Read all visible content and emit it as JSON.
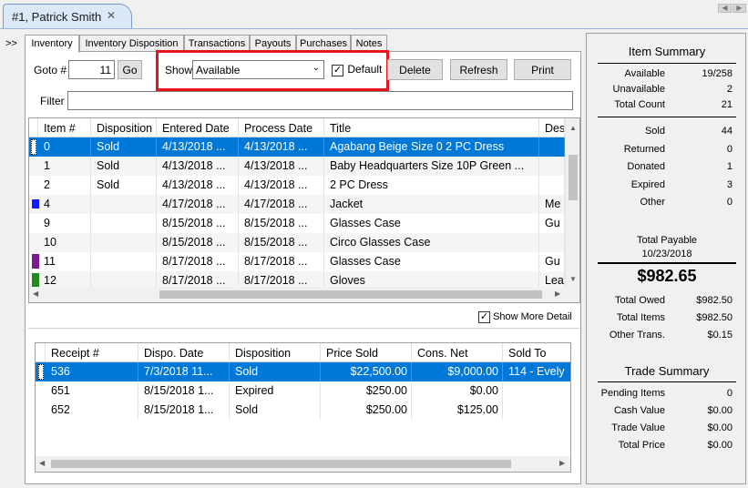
{
  "document_tab": {
    "label": "#1, Patrick Smith",
    "close": "✕"
  },
  "chevron": ">>",
  "tabs": [
    {
      "label": "Inventory"
    },
    {
      "label": "Inventory Disposition"
    },
    {
      "label": "Transactions"
    },
    {
      "label": "Payouts"
    },
    {
      "label": "Purchases"
    },
    {
      "label": "Notes"
    }
  ],
  "toolbar": {
    "goto_label": "Goto #",
    "goto_value": "11",
    "go_button": "Go",
    "show_label": "Show",
    "show_value": "Available",
    "default_label": "Default",
    "default_checked": "✓",
    "delete_button": "Delete",
    "refresh_button": "Refresh",
    "print_button": "Print",
    "filter_label": "Filter",
    "filter_value": ""
  },
  "inventory_grid": {
    "columns": [
      "Item #",
      "Disposition",
      "Entered Date",
      "Process Date",
      "Title",
      "Descri"
    ],
    "rows": [
      {
        "item": "0",
        "disposition": "Sold",
        "entered": "4/13/2018 ...",
        "process": "4/13/2018 ...",
        "title": "Agabang Beige Size 0 2 PC Dress",
        "desc": "",
        "marker": "",
        "selected": true
      },
      {
        "item": "1",
        "disposition": "Sold",
        "entered": "4/13/2018 ...",
        "process": "4/13/2018 ...",
        "title": "Baby Headquarters Size 10P Green ...",
        "desc": "",
        "marker": "",
        "selected": false
      },
      {
        "item": "2",
        "disposition": "Sold",
        "entered": "4/13/2018 ...",
        "process": "4/13/2018 ...",
        "title": "2 PC Dress",
        "desc": "",
        "marker": "",
        "selected": false
      },
      {
        "item": "4",
        "disposition": "",
        "entered": "4/17/2018 ...",
        "process": "4/17/2018 ...",
        "title": "Jacket",
        "desc": "Me",
        "marker": "#1a1aff",
        "selected": false
      },
      {
        "item": "9",
        "disposition": "",
        "entered": "8/15/2018 ...",
        "process": "8/15/2018 ...",
        "title": "Glasses Case",
        "desc": "Gu",
        "marker": "",
        "selected": false
      },
      {
        "item": "10",
        "disposition": "",
        "entered": "8/15/2018 ...",
        "process": "8/15/2018 ...",
        "title": "Circo Glasses Case",
        "desc": "",
        "marker": "",
        "selected": false
      },
      {
        "item": "11",
        "disposition": "",
        "entered": "8/17/2018 ...",
        "process": "8/17/2018 ...",
        "title": "Glasses Case",
        "desc": "Gu",
        "marker": "#7b1a8c",
        "selected": false
      },
      {
        "item": "12",
        "disposition": "",
        "entered": "8/17/2018 ...",
        "process": "8/17/2018 ...",
        "title": "Gloves",
        "desc": "Lea",
        "marker": "#1e8a1e",
        "selected": false
      }
    ]
  },
  "show_more_detail": {
    "label": "Show More Detail",
    "checked": "✓"
  },
  "disposition_grid": {
    "columns": [
      "Receipt #",
      "Dispo. Date",
      "Disposition",
      "Price Sold",
      "Cons. Net",
      "Sold To"
    ],
    "rows": [
      {
        "receipt": "536",
        "date": "7/3/2018 11...",
        "disposition": "Sold",
        "price": "$22,500.00",
        "net": "$9,000.00",
        "sold_to": "114 - Evely",
        "selected": true
      },
      {
        "receipt": "651",
        "date": "8/15/2018 1...",
        "disposition": "Expired",
        "price": "$250.00",
        "net": "$0.00",
        "sold_to": "",
        "selected": false
      },
      {
        "receipt": "652",
        "date": "8/15/2018 1...",
        "disposition": "Sold",
        "price": "$250.00",
        "net": "$125.00",
        "sold_to": "",
        "selected": false
      }
    ]
  },
  "item_summary": {
    "title": "Item Summary",
    "available_label": "Available",
    "available": "19/258",
    "unavailable_label": "Unavailable",
    "unavailable": "2",
    "total_count_label": "Total Count",
    "total_count": "21",
    "sold_label": "Sold",
    "sold": "44",
    "returned_label": "Returned",
    "returned": "0",
    "donated_label": "Donated",
    "donated": "1",
    "expired_label": "Expired",
    "expired": "3",
    "other_label": "Other",
    "other": "0",
    "total_payable_label": "Total Payable",
    "total_payable_date": "10/23/2018",
    "total_payable": "$982.65",
    "total_owed_label": "Total Owed",
    "total_owed": "$982.50",
    "total_items_label": "Total Items",
    "total_items": "$982.50",
    "other_trans_label": "Other Trans.",
    "other_trans": "$0.15"
  },
  "trade_summary": {
    "title": "Trade Summary",
    "pending_label": "Pending Items",
    "pending": "0",
    "cash_label": "Cash Value",
    "cash": "$0.00",
    "trade_label": "Trade Value",
    "trade": "$0.00",
    "total_price_label": "Total Price",
    "total_price": "$0.00"
  }
}
